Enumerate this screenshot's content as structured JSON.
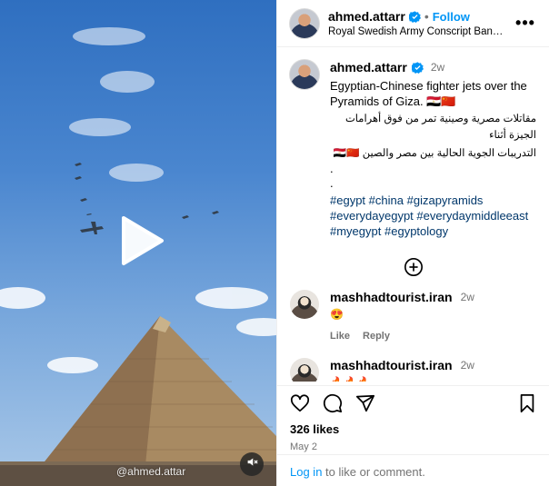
{
  "post": {
    "username": "ahmed.attarr",
    "follow_label": "Follow",
    "separator": "•",
    "audio": "Royal Swedish Army Conscript Band, ...",
    "more_label": "•••"
  },
  "media": {
    "watermark": "@ahmed.attar"
  },
  "caption": {
    "username": "ahmed.attarr",
    "time": "2w",
    "text": "Egyptian-Chinese fighter jets over the Pyramids of Giza. 🇪🇬🇨🇳",
    "arabic_line1": "مقاتلات مصرية وصينية تمر من فوق أهرامات الجيزة أثناء",
    "arabic_line2": "التدريبات الجوية الحالية بين مصر والصين 🇪🇬🇨🇳",
    "dot1": ".",
    "dot2": ".",
    "hashtags": [
      "#egypt",
      "#china",
      "#gizapyramids",
      "#everydayegypt",
      "#everydaymiddleeast",
      "#myegypt",
      "#egyptology"
    ]
  },
  "comments": [
    {
      "username": "mashhadtourist.iran",
      "time": "2w",
      "text": "😍",
      "like_label": "Like",
      "reply_label": "Reply"
    },
    {
      "username": "mashhadtourist.iran",
      "time": "2w",
      "text": "🔥🔥🔥"
    }
  ],
  "stats": {
    "likes": "326 likes",
    "date": "May 2"
  },
  "login": {
    "link": "Log in",
    "rest": " to like or comment."
  },
  "colors": {
    "accent": "#0095f6",
    "hashtag": "#00376b",
    "muted": "#737373"
  },
  "icons": [
    "verified-badge-icon",
    "more-options-icon",
    "add-circle-icon",
    "heart-icon",
    "comment-icon",
    "share-icon",
    "bookmark-icon",
    "play-icon",
    "mute-icon"
  ]
}
